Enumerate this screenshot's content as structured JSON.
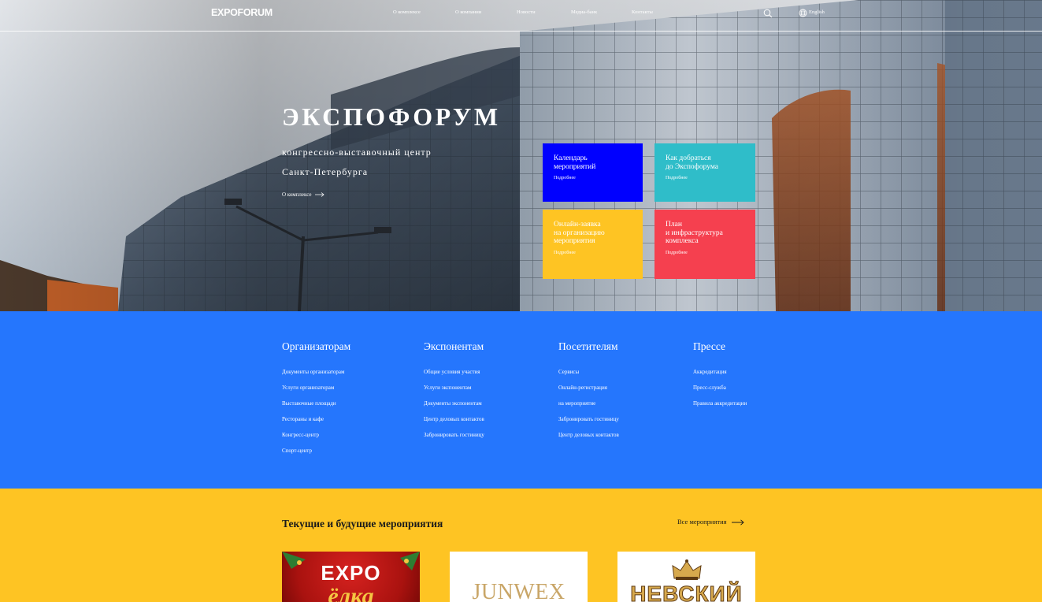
{
  "header": {
    "logo": "EXPOFORUM",
    "nav": [
      "О комплексе",
      "О компании",
      "Новости",
      "Медиа-банк",
      "Контакты"
    ],
    "language": "English"
  },
  "hero": {
    "title": "ЭКСПОФОРУМ",
    "subtitle_line1": "конгрессно-выставочный центр",
    "subtitle_line2": "Санкт-Петербурга",
    "about_link": "О комплексе",
    "tiles": [
      {
        "title": "Календарь\nмероприятий",
        "more": "Подробнее",
        "color": "#0000ff"
      },
      {
        "title": "Как добраться\nдо Экспофорума",
        "more": "Подробнее",
        "color": "#2fbdc9"
      },
      {
        "title": "Онлайн-заявка\nна организацию\nмероприятия",
        "more": "Подробнее",
        "color": "#fec423"
      },
      {
        "title": "План\nи инфраструктура\nкомплекса",
        "more": "Подробнее",
        "color": "#f5404f"
      }
    ]
  },
  "links": {
    "background": "#2576fd",
    "columns": [
      {
        "heading": "Организаторам",
        "items": [
          "Документы организаторам",
          "Услуги организаторам",
          "Выставочные площади",
          "Рестораны и кафе",
          "Конгресс-центр",
          "Спорт-центр"
        ]
      },
      {
        "heading": "Экспонентам",
        "items": [
          "Общие условия участия",
          "Услуги экспонентам",
          "Документы экспонентам",
          "Центр деловых контактов",
          "Забронировать гостиницу"
        ]
      },
      {
        "heading": "Посетителям",
        "items": [
          "Сервисы",
          "Онлайн-регистрация",
          "на мероприятие",
          "Забронировать гостиницу",
          "Центр деловых контактов"
        ]
      },
      {
        "heading": "Прессе",
        "items": [
          "Аккредитация",
          "Пресс-служба",
          "Правила аккредитации"
        ]
      }
    ]
  },
  "events": {
    "background": "#fec423",
    "title": "Текущие и будущие мероприятия",
    "all_link": "Все мероприятия",
    "cards": [
      {
        "line1": "EXPO",
        "line2": "ёлка"
      },
      {
        "line1": "JUNWEX"
      },
      {
        "line1": "НЕВСКИЙ"
      }
    ]
  }
}
